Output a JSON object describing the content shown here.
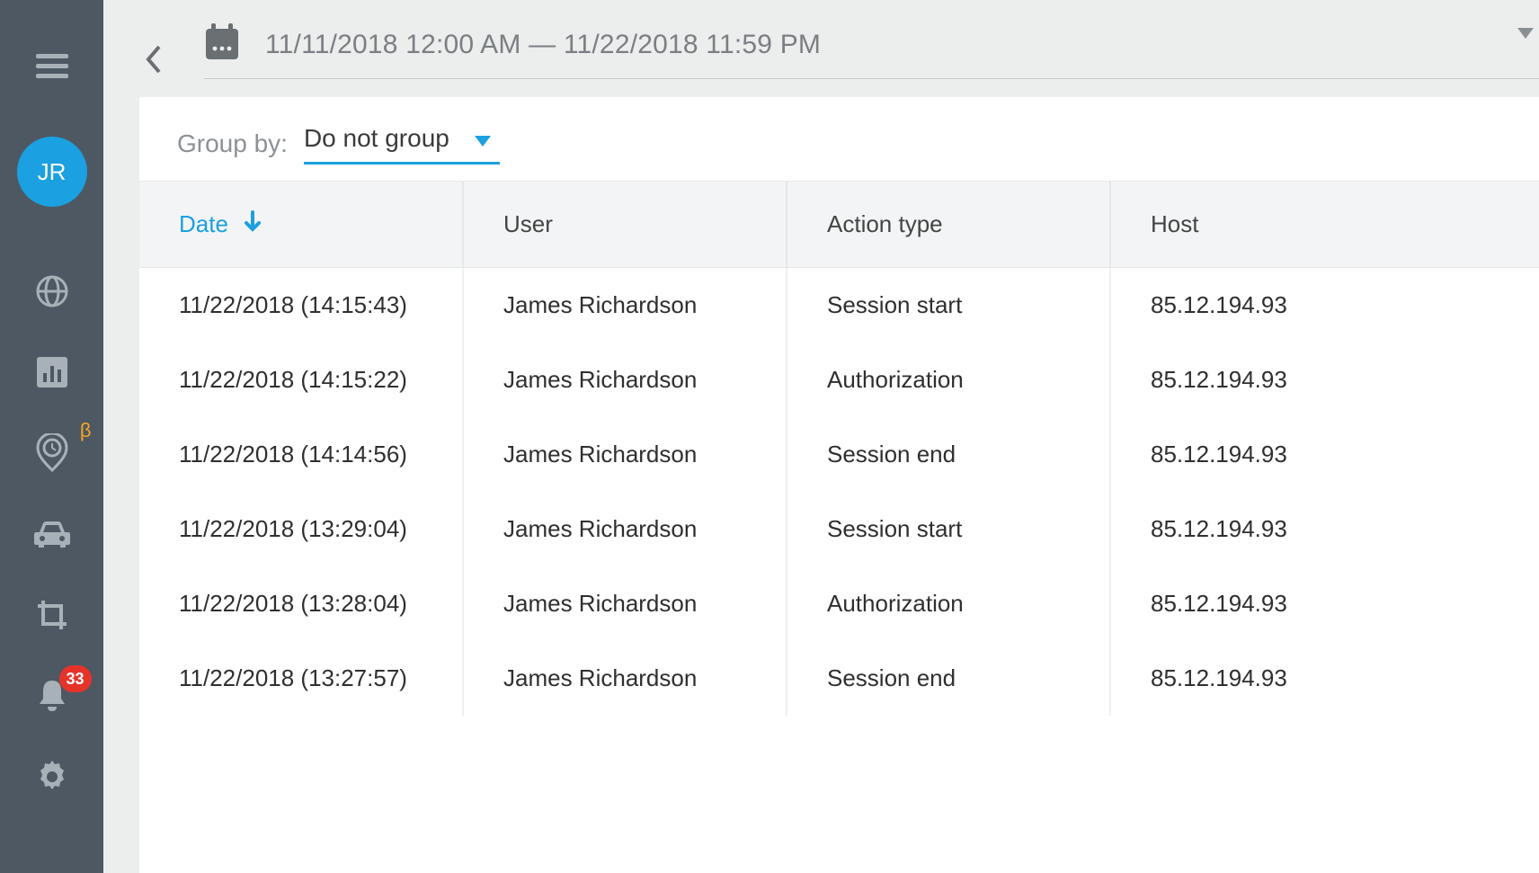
{
  "sidebar": {
    "avatar_initials": "JR",
    "beta_badge": "β",
    "notification_count": "33"
  },
  "header": {
    "date_range": "11/11/2018 12:00 AM — 11/22/2018 11:59 PM"
  },
  "groupbar": {
    "label": "Group by:",
    "selected": "Do not group"
  },
  "table": {
    "columns": {
      "date": "Date",
      "user": "User",
      "action": "Action type",
      "host": "Host"
    },
    "rows": [
      {
        "date": "11/22/2018 (14:15:43)",
        "user": "James Richardson",
        "action": "Session start",
        "host": "85.12.194.93"
      },
      {
        "date": "11/22/2018 (14:15:22)",
        "user": "James Richardson",
        "action": "Authorization",
        "host": "85.12.194.93"
      },
      {
        "date": "11/22/2018 (14:14:56)",
        "user": "James Richardson",
        "action": "Session end",
        "host": "85.12.194.93"
      },
      {
        "date": "11/22/2018 (13:29:04)",
        "user": "James Richardson",
        "action": "Session start",
        "host": "85.12.194.93"
      },
      {
        "date": "11/22/2018 (13:28:04)",
        "user": "James Richardson",
        "action": "Authorization",
        "host": "85.12.194.93"
      },
      {
        "date": "11/22/2018 (13:27:57)",
        "user": "James Richardson",
        "action": "Session end",
        "host": "85.12.194.93"
      }
    ]
  }
}
